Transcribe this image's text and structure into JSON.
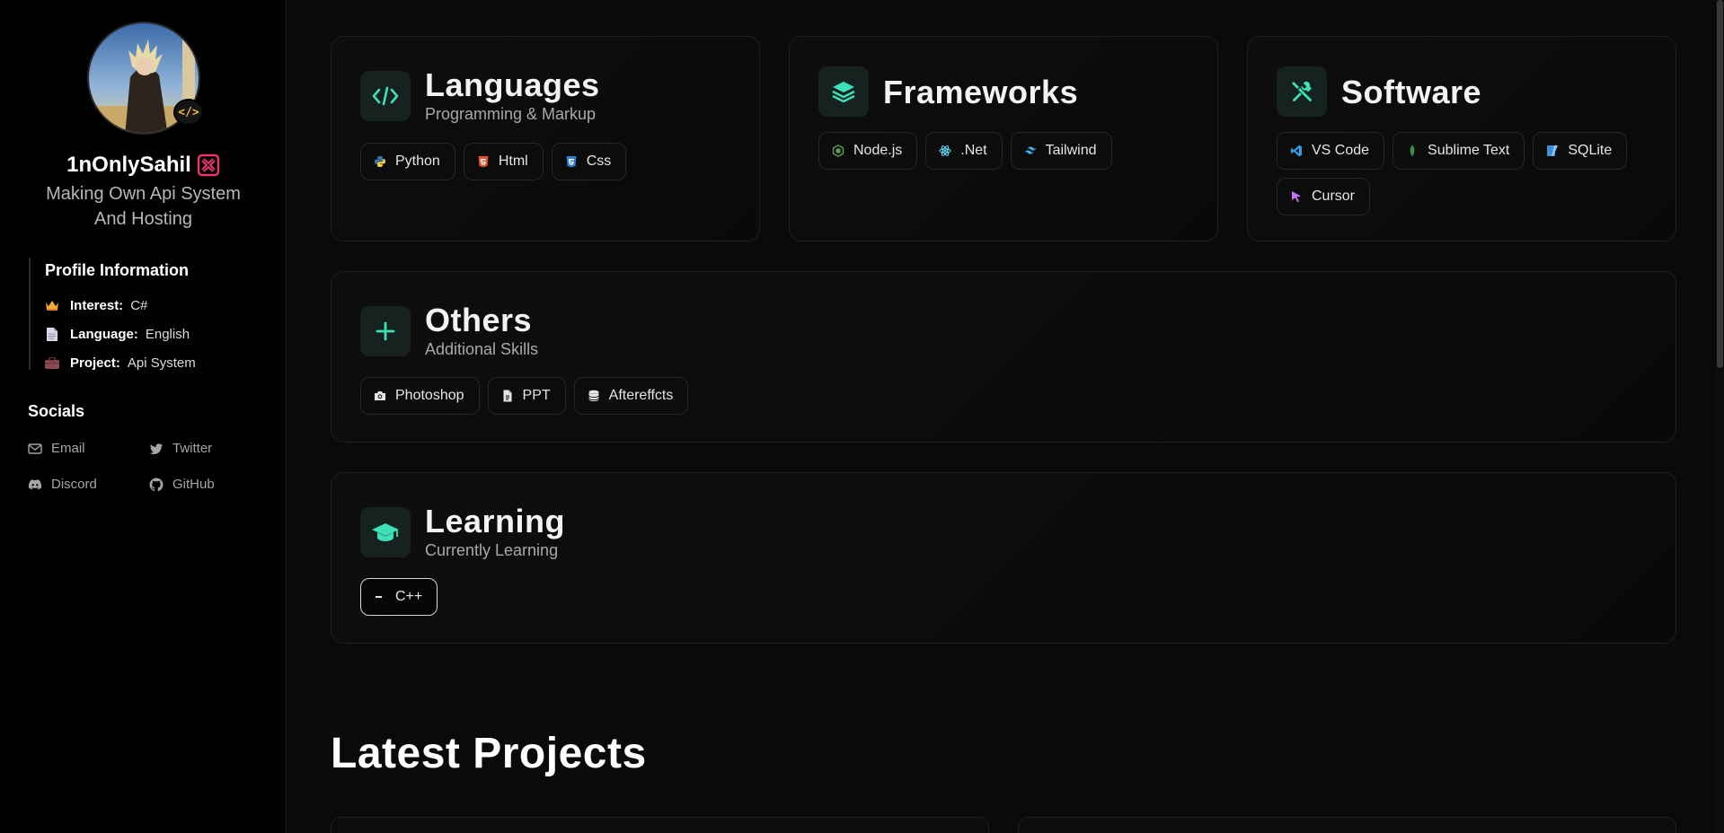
{
  "profile": {
    "name": "1nOnlySahil",
    "tagline": "Making Own Api System And Hosting",
    "badge": "</>"
  },
  "profile_info": {
    "title": "Profile Information",
    "rows": [
      {
        "key": "Interest:",
        "value": "C#",
        "icon": "crown-icon"
      },
      {
        "key": "Language:",
        "value": "English",
        "icon": "document-icon"
      },
      {
        "key": "Project:",
        "value": "Api System",
        "icon": "briefcase-icon"
      }
    ]
  },
  "socials": {
    "title": "Socials",
    "items": [
      {
        "label": "Email",
        "icon": "envelope-icon"
      },
      {
        "label": "Twitter",
        "icon": "twitter-icon"
      },
      {
        "label": "Discord",
        "icon": "discord-icon"
      },
      {
        "label": "GitHub",
        "icon": "github-icon"
      }
    ]
  },
  "skills": {
    "languages": {
      "title": "Languages",
      "subtitle": "Programming & Markup",
      "chips": [
        "Python",
        "Html",
        "Css"
      ]
    },
    "frameworks": {
      "title": "Frameworks",
      "chips": [
        "Node.js",
        ".Net",
        "Tailwind"
      ]
    },
    "software": {
      "title": "Software",
      "chips": [
        "VS Code",
        "Sublime Text",
        "SQLite",
        "Cursor"
      ]
    },
    "others": {
      "title": "Others",
      "subtitle": "Additional Skills",
      "chips": [
        "Photoshop",
        "PPT",
        "Aftereffcts"
      ]
    },
    "learning": {
      "title": "Learning",
      "subtitle": "Currently Learning",
      "chips": [
        "C++"
      ]
    }
  },
  "projects": {
    "title": "Latest Projects"
  },
  "colors": {
    "accent": "#3ee0b8",
    "background": "#0a0a0a",
    "sidebar": "#000000",
    "name_emoji": "#e8336f"
  }
}
